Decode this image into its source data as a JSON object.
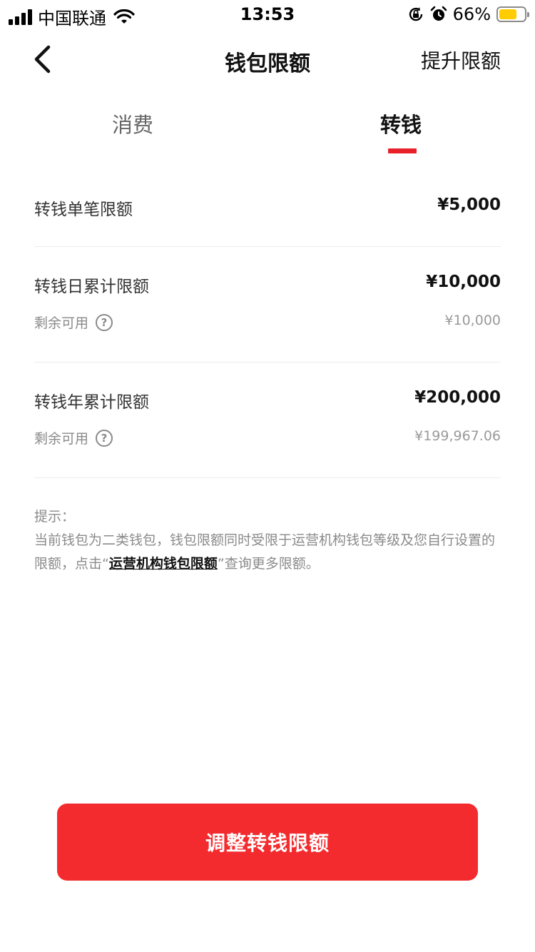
{
  "status_bar": {
    "carrier": "中国联通",
    "time": "13:53",
    "battery_percent": "66%",
    "battery_level": 0.66,
    "battery_color": "#ffcc00"
  },
  "nav": {
    "title": "钱包限额",
    "action": "提升限额"
  },
  "tabs": [
    {
      "label": "消费",
      "active": false
    },
    {
      "label": "转钱",
      "active": true
    }
  ],
  "accent_color": "#e8202a",
  "limits": [
    {
      "label": "转钱单笔限额",
      "value": "¥5,000"
    },
    {
      "label": "转钱日累计限额",
      "value": "¥10,000",
      "remaining_label": "剩余可用",
      "remaining_value": "¥10,000"
    },
    {
      "label": "转钱年累计限额",
      "value": "¥200,000",
      "remaining_label": "剩余可用",
      "remaining_value": "¥199,967.06"
    }
  ],
  "tips": {
    "title": "提示：",
    "text_before": "当前钱包为二类钱包，钱包限额同时受限于运营机构钱包等级及您自行设置的限额，点击“",
    "link": "运营机构钱包限额",
    "text_after": "”查询更多限额。"
  },
  "button": {
    "label": "调整转钱限额",
    "color": "#f42b2e"
  },
  "icons": {
    "help": "?"
  }
}
